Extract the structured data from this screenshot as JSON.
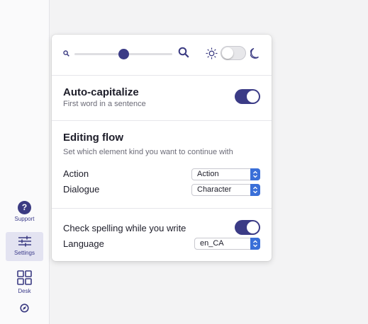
{
  "sidebar": {
    "items": [
      {
        "label": "Support",
        "icon": "help-icon"
      },
      {
        "label": "Settings",
        "icon": "sliders-icon",
        "active": true
      },
      {
        "label": "Desk",
        "icon": "grid-icon"
      }
    ],
    "bottom_icon": "compass-icon"
  },
  "zoom": {
    "level": 0.5
  },
  "theme": {
    "dark_mode": false
  },
  "auto_capitalize": {
    "title": "Auto-capitalize",
    "subtitle": "First word in a sentence",
    "enabled": true
  },
  "editing_flow": {
    "title": "Editing flow",
    "subtitle": "Set which element kind you want to continue with",
    "rows": [
      {
        "label": "Action",
        "value": "Action"
      },
      {
        "label": "Dialogue",
        "value": "Character"
      }
    ]
  },
  "spelling": {
    "label": "Check spelling while you write",
    "enabled": true,
    "language_label": "Language",
    "language_value": "en_CA"
  },
  "colors": {
    "accent": "#3b3b86",
    "stepper": "#3a6fd8"
  }
}
